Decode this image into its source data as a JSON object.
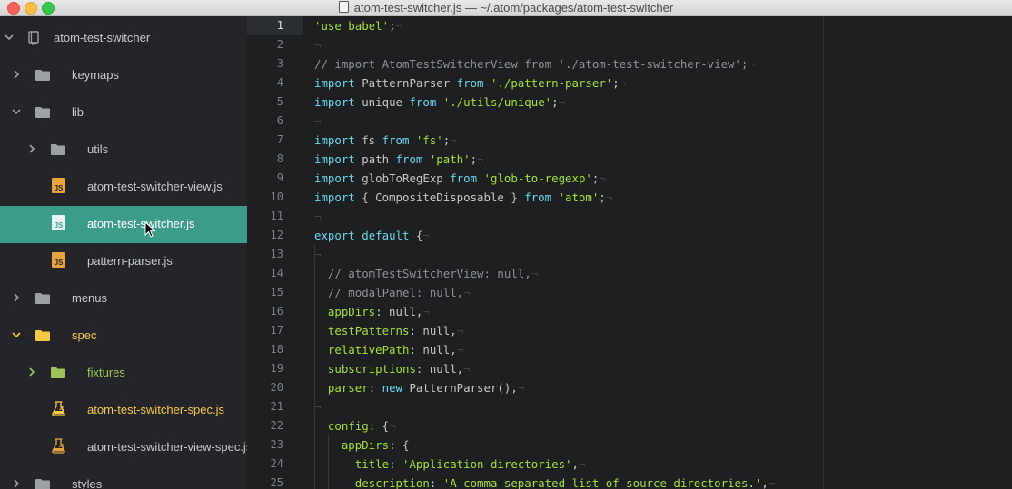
{
  "window": {
    "title": "atom-test-switcher.js — ~/.atom/packages/atom-test-switcher"
  },
  "tree": {
    "root": {
      "label": "atom-test-switcher",
      "icon": "repo-icon"
    },
    "items": [
      {
        "label": "keymaps",
        "type": "folder",
        "expanded": false,
        "depth": 1
      },
      {
        "label": "lib",
        "type": "folder",
        "expanded": true,
        "depth": 1
      },
      {
        "label": "utils",
        "type": "folder",
        "expanded": false,
        "depth": 2
      },
      {
        "label": "atom-test-switcher-view.js",
        "type": "js",
        "depth": 2
      },
      {
        "label": "atom-test-switcher.js",
        "type": "js",
        "depth": 2,
        "selected": true
      },
      {
        "label": "pattern-parser.js",
        "type": "js",
        "depth": 2
      },
      {
        "label": "menus",
        "type": "folder",
        "expanded": false,
        "depth": 1
      },
      {
        "label": "spec",
        "type": "folder",
        "expanded": true,
        "depth": 1,
        "modified": true
      },
      {
        "label": "fixtures",
        "type": "folder",
        "expanded": false,
        "depth": 2,
        "added": true
      },
      {
        "label": "atom-test-switcher-spec.js",
        "type": "spec",
        "depth": 2,
        "modified": true
      },
      {
        "label": "atom-test-switcher-view-spec.js",
        "type": "spec",
        "depth": 2
      },
      {
        "label": "styles",
        "type": "folder",
        "expanded": false,
        "depth": 1
      }
    ]
  },
  "editor": {
    "current_line": 1,
    "lines": [
      {
        "n": "1",
        "text": "'use babel';"
      },
      {
        "n": "2",
        "text": ""
      },
      {
        "n": "3",
        "text": "// import AtomTestSwitcherView from './atom-test-switcher-view';"
      },
      {
        "n": "4",
        "text": "import PatternParser from './pattern-parser';"
      },
      {
        "n": "5",
        "text": "import unique from './utils/unique';"
      },
      {
        "n": "6",
        "text": ""
      },
      {
        "n": "7",
        "text": "import fs from 'fs';"
      },
      {
        "n": "8",
        "text": "import path from 'path';"
      },
      {
        "n": "9",
        "text": "import globToRegExp from 'glob-to-regexp';"
      },
      {
        "n": "10",
        "text": "import { CompositeDisposable } from 'atom';"
      },
      {
        "n": "11",
        "text": ""
      },
      {
        "n": "12",
        "text": "export default {"
      },
      {
        "n": "13",
        "text": ""
      },
      {
        "n": "14",
        "text": "  // atomTestSwitcherView: null,"
      },
      {
        "n": "15",
        "text": "  // modalPanel: null,"
      },
      {
        "n": "16",
        "text": "  appDirs: null,"
      },
      {
        "n": "17",
        "text": "  testPatterns: null,"
      },
      {
        "n": "18",
        "text": "  relativePath: null,"
      },
      {
        "n": "19",
        "text": "  subscriptions: null,"
      },
      {
        "n": "20",
        "text": "  parser: new PatternParser(),"
      },
      {
        "n": "21",
        "text": ""
      },
      {
        "n": "22",
        "text": "  config: {"
      },
      {
        "n": "23",
        "text": "    appDirs: {"
      },
      {
        "n": "24",
        "text": "      title: 'Application directories',"
      },
      {
        "n": "25",
        "text": "      description: 'A comma-separated list of source directories.',"
      }
    ]
  },
  "colors": {
    "keyword": "#66d9ef",
    "string": "#a6e22e",
    "comment": "#8e9297",
    "selection": "#3c9c8a",
    "modified": "#f6c743",
    "added": "#9ec35a"
  }
}
